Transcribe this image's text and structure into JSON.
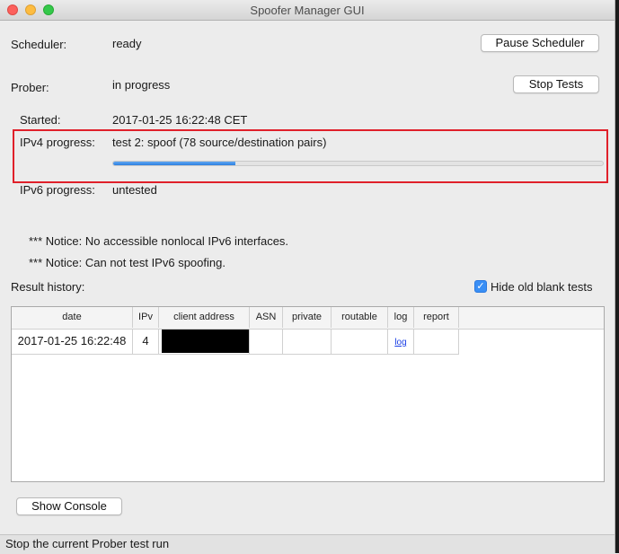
{
  "window": {
    "title": "Spoofer Manager GUI"
  },
  "scheduler": {
    "label": "Scheduler:",
    "value": "ready",
    "button": "Pause Scheduler"
  },
  "prober": {
    "label": "Prober:",
    "value": "in progress",
    "button": "Stop Tests"
  },
  "started": {
    "label": "Started:",
    "value": "2017-01-25 16:22:48 CET"
  },
  "ipv4": {
    "label": "IPv4 progress:",
    "value": "test 2:  spoof (78 source/destination pairs)",
    "progress_fraction": 0.25
  },
  "ipv6": {
    "label": "IPv6 progress:",
    "value": "untested"
  },
  "notices": [
    "*** Notice: No accessible nonlocal IPv6 interfaces.",
    "*** Notice: Can not test IPv6 spoofing."
  ],
  "history": {
    "label": "Result history:",
    "hide_blank": {
      "label": "Hide old blank tests",
      "checked": true
    },
    "columns": [
      "date",
      "IPv",
      "client address",
      "ASN",
      "private",
      "routable",
      "log",
      "report"
    ],
    "rows": [
      {
        "date": "2017-01-25 16:22:48",
        "ipv": "4",
        "client_address": "",
        "asn": "",
        "private": "",
        "routable": "",
        "log": "log",
        "report": ""
      }
    ]
  },
  "console_button": "Show Console",
  "status_bar": "Stop the current Prober test run",
  "colors": {
    "progress": "#2d7fe0",
    "highlight": "#e0202a",
    "checkbox": "#3a8ff5"
  }
}
